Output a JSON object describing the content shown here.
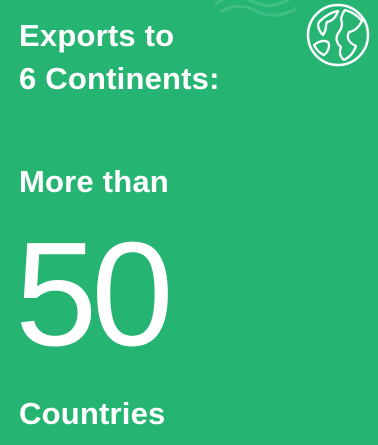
{
  "card": {
    "background_color": "#26b473",
    "text_color": "#ffffff"
  },
  "headline": {
    "line1": "Exports to",
    "line2": "6 Continents:"
  },
  "subheadline": "More than",
  "highlight": {
    "value": "50",
    "unit": "Countries"
  },
  "icons": {
    "globe": "globe-icon",
    "background": "watermark-mark"
  }
}
